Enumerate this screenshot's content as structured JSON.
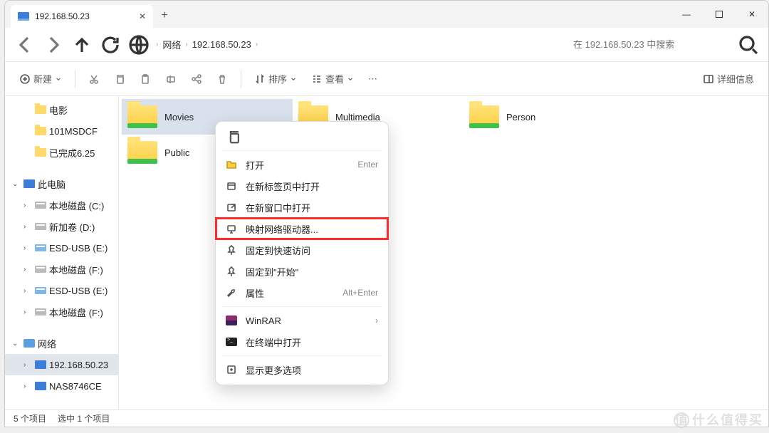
{
  "tab": {
    "title": "192.168.50.23"
  },
  "breadcrumbs": {
    "root": "网络",
    "host": "192.168.50.23"
  },
  "search": {
    "placeholder": "在 192.168.50.23 中搜索"
  },
  "toolbar": {
    "new": "新建",
    "sort": "排序",
    "view": "查看",
    "details": "详细信息"
  },
  "sidebar": {
    "quick": [
      {
        "label": "电影"
      },
      {
        "label": "101MSDCF"
      },
      {
        "label": "已完成6.25"
      }
    ],
    "thispc": {
      "label": "此电脑"
    },
    "drives": [
      {
        "label": "本地磁盘 (C:)"
      },
      {
        "label": "新加卷 (D:)"
      },
      {
        "label": "ESD-USB (E:)"
      },
      {
        "label": "本地磁盘 (F:)"
      },
      {
        "label": "ESD-USB (E:)"
      },
      {
        "label": "本地磁盘 (F:)"
      }
    ],
    "network": {
      "label": "网络"
    },
    "hosts": [
      {
        "label": "192.168.50.23"
      },
      {
        "label": "NAS8746CE"
      }
    ]
  },
  "folders": [
    {
      "name": "Movies"
    },
    {
      "name": "Multimedia"
    },
    {
      "name": "Person"
    },
    {
      "name": "Public"
    }
  ],
  "context": {
    "open": "打开",
    "open_short": "Enter",
    "open_newtab": "在新标签页中打开",
    "open_newwin": "在新窗口中打开",
    "map_drive": "映射网络驱动器...",
    "pin_quick": "固定到快速访问",
    "pin_start": "固定到\"开始\"",
    "properties": "属性",
    "properties_short": "Alt+Enter",
    "winrar": "WinRAR",
    "open_terminal": "在终端中打开",
    "more": "显示更多选项"
  },
  "status": {
    "count": "5 个项目",
    "selected": "选中 1 个项目"
  },
  "watermark": "什么值得买"
}
